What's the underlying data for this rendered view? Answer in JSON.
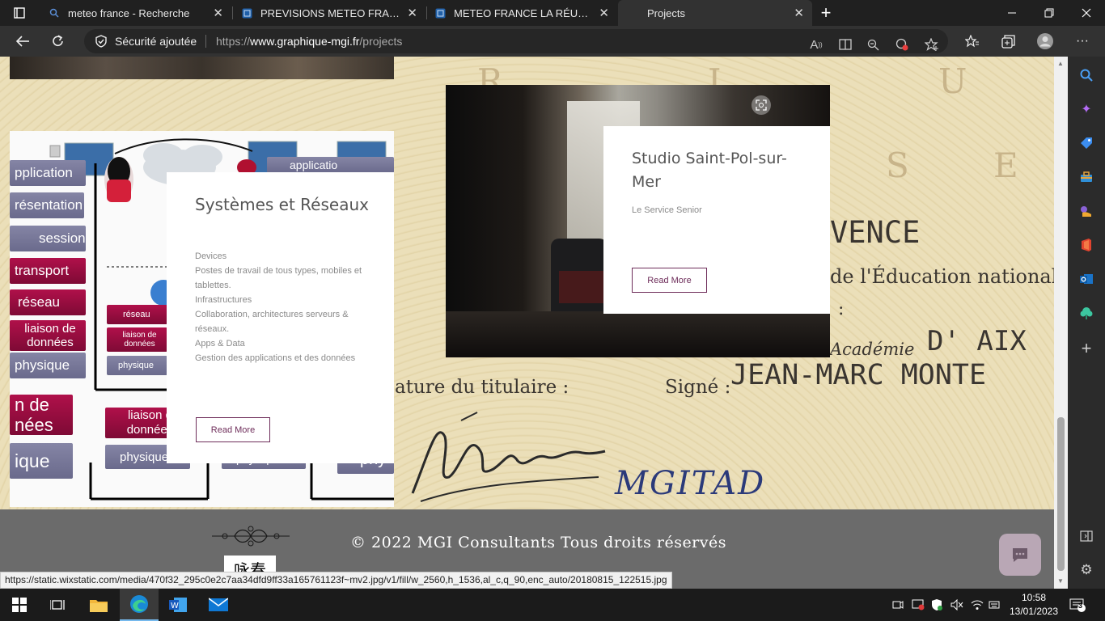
{
  "browser": {
    "tabs": [
      {
        "title": "meteo france - Recherche",
        "icon": "search-icon"
      },
      {
        "title": "PREVISIONS METEO FRANCE - Site",
        "icon": "site-favicon"
      },
      {
        "title": "METEO FRANCE LA RÉUNION par",
        "icon": "site-favicon"
      },
      {
        "title": "Projects",
        "icon": "none"
      }
    ],
    "new_tab": "+",
    "security_label": "Sécurité ajoutée",
    "url_prefix": "https://",
    "url_domain": "www.graphique-mgi.fr",
    "url_path": "/projects"
  },
  "projects": [
    {
      "title": "Systèmes et Réseaux",
      "lines": [
        "Devices",
        "Postes de travail de tous types, mobiles et tablettes.",
        "Infrastructures",
        "Collaboration, architectures serveurs & réseaux.",
        "Apps & Data",
        "Gestion des applications et des données"
      ],
      "button": "Read More"
    },
    {
      "title": "Studio Saint-Pol-sur-Mer",
      "subtitle": "Le Service Senior",
      "button": "Read More"
    }
  ],
  "network_diagram": {
    "layers_left": [
      "pplication",
      "résentation",
      "session",
      "transport",
      "réseau",
      "liaison de données",
      "physique"
    ],
    "layers_mid": [
      "réseau",
      "liaison de données",
      "physique"
    ],
    "layers_bottom_left": [
      "n de nées",
      "ique"
    ],
    "layers_bottom_mid": [
      "liaison d données",
      "physique"
    ],
    "layers_bottom_right": [
      "physique",
      "phy"
    ],
    "top_right_label": "applicatio"
  },
  "diploma": {
    "letters": [
      "R",
      "L",
      "U",
      "S",
      "E"
    ],
    "province": "VENCE",
    "education": "de l'Éducation nationale",
    "academie": "Académie",
    "aix": "D' AIX",
    "titulaire": "ature du titulaire :",
    "signe": "Signé :",
    "rector": "JEAN-MARC MONTE",
    "handwritten": "MGITAD"
  },
  "footer": {
    "copyright": "© 2022 MGI Consultants Tous droits réservés",
    "logo_text": "咏春"
  },
  "status_bar_url": "https://static.wixstatic.com/media/470f32_295c0e2c7aa34dfd9ff33a165761123f~mv2.jpg/v1/fill/w_2560,h_1536,al_c,q_90,enc_auto/20180815_122515.jpg",
  "taskbar": {
    "time": "10:58",
    "date": "13/01/2023",
    "notifications": "3"
  }
}
